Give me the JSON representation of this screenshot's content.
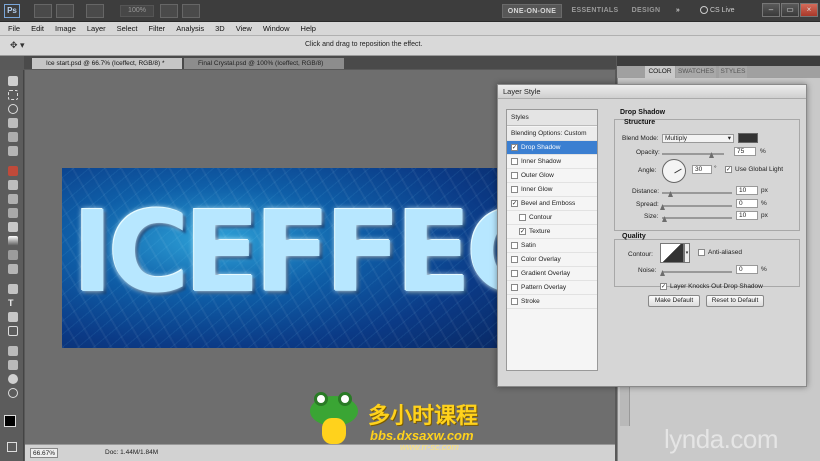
{
  "appbar": {
    "logo": "Ps",
    "zoom": "100%",
    "workspaces": [
      "ONE-ON-ONE",
      "ESSENTIALS",
      "DESIGN"
    ],
    "more": "»",
    "cslive": "CS Live"
  },
  "menu": [
    "File",
    "Edit",
    "Image",
    "Layer",
    "Select",
    "Filter",
    "Analysis",
    "3D",
    "View",
    "Window",
    "Help"
  ],
  "options": {
    "hint": "Click and drag to reposition the effect."
  },
  "tabs": [
    {
      "label": "Ice start.psd @ 66.7% (Iceffect, RGB/8) *"
    },
    {
      "label": "Final Crystal.psd @ 100% (Iceffect, RGB/8)"
    }
  ],
  "canvas": {
    "text": "ICEFFEC"
  },
  "status": {
    "zoom": "66.67%",
    "doc": "Doc: 1.44M/1.84M"
  },
  "right_panel": {
    "tabs": [
      "COLOR",
      "SWATCHES",
      "STYLES"
    ]
  },
  "dialog": {
    "title": "Layer Style",
    "list": [
      {
        "label": "Styles",
        "checked": null
      },
      {
        "label": "Blending Options: Custom",
        "checked": null
      },
      {
        "label": "Drop Shadow",
        "checked": true
      },
      {
        "label": "Inner Shadow",
        "checked": false
      },
      {
        "label": "Outer Glow",
        "checked": false
      },
      {
        "label": "Inner Glow",
        "checked": false
      },
      {
        "label": "Bevel and Emboss",
        "checked": true
      },
      {
        "label": "Contour",
        "checked": false
      },
      {
        "label": "Texture",
        "checked": true
      },
      {
        "label": "Satin",
        "checked": false
      },
      {
        "label": "Color Overlay",
        "checked": false
      },
      {
        "label": "Gradient Overlay",
        "checked": false
      },
      {
        "label": "Pattern Overlay",
        "checked": false
      },
      {
        "label": "Stroke",
        "checked": false
      }
    ],
    "section_title": "Drop Shadow",
    "structure_title": "Structure",
    "blend_mode_label": "Blend Mode:",
    "blend_mode_value": "Multiply",
    "shadow_color": "#333333",
    "opacity_label": "Opacity:",
    "opacity_value": "75",
    "angle_label": "Angle:",
    "angle_value": "30",
    "degree": "°",
    "use_global_light": "Use Global Light",
    "distance_label": "Distance:",
    "distance_value": "10",
    "spread_label": "Spread:",
    "spread_value": "0",
    "size_label": "Size:",
    "size_value": "10",
    "px": "px",
    "percent": "%",
    "quality_title": "Quality",
    "contour_label": "Contour:",
    "anti_aliased": "Anti-aliased",
    "noise_label": "Noise:",
    "noise_value": "0",
    "knockout": "Layer Knocks Out Drop Shadow",
    "make_default": "Make Default",
    "reset_default": "Reset to Default"
  },
  "watermark": {
    "cn": "多小时课程",
    "url": "bbs.dxsaxw.com",
    "url2": "www.rr-sc.com",
    "lynda": "lynda.com"
  },
  "colors": {
    "selection": "#3b7fd1",
    "accent_yellow": "#ffd21c"
  },
  "icons": [
    "ps-logo-icon",
    "screen-mode-icon",
    "arrange-icon",
    "cslive-icon",
    "minimize-icon",
    "restore-icon",
    "close-icon",
    "move-tool-icon",
    "check-icon",
    "angle-dial-icon",
    "contour-preview-icon"
  ]
}
